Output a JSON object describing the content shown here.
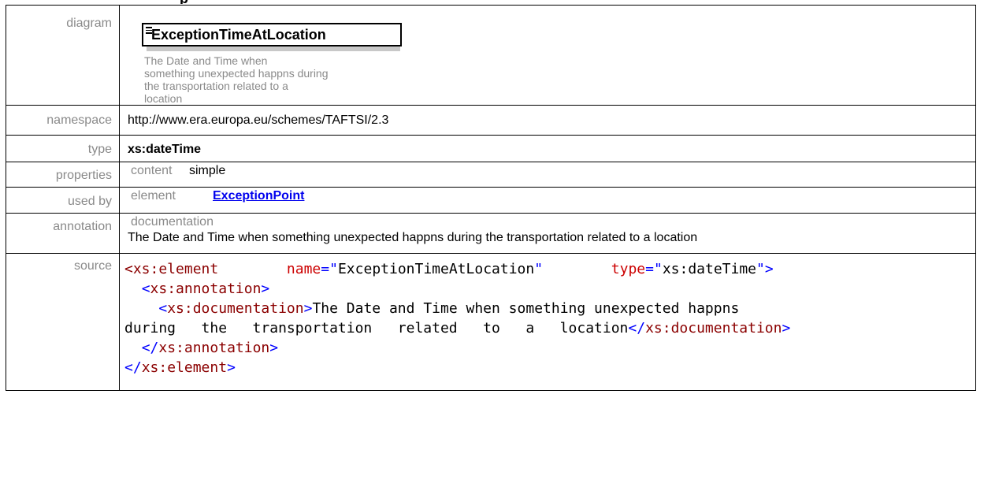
{
  "top_cut_text": "p",
  "rows": {
    "diagram": {
      "label": "diagram",
      "element_name": "ExceptionTimeAtLocation",
      "documentation_lines": [
        "The Date and Time when",
        "something unexpected happns during",
        "the transportation related to a",
        "location"
      ]
    },
    "namespace": {
      "label": "namespace",
      "value": "http://www.era.europa.eu/schemes/TAFTSI/2.3"
    },
    "type": {
      "label": "type",
      "value": "xs:dateTime"
    },
    "properties": {
      "label": "properties",
      "key": "content",
      "value": "simple"
    },
    "used_by": {
      "label": "used by",
      "kind": "element",
      "link": "ExceptionPoint"
    },
    "annotation": {
      "label": "annotation",
      "key": "documentation",
      "text": "The Date and Time when something unexpected happns during the transportation related to a location"
    },
    "source": {
      "label": "source",
      "lines": [
        [
          {
            "c": "tg",
            "t": "<xs:element"
          },
          {
            "c": "tx",
            "t": "        "
          },
          {
            "c": "at",
            "t": "name"
          },
          {
            "c": "pn",
            "t": "="
          },
          {
            "c": "st",
            "t": "\""
          },
          {
            "c": "tx",
            "t": "ExceptionTimeAtLocation"
          },
          {
            "c": "st",
            "t": "\""
          },
          {
            "c": "tx",
            "t": "        "
          },
          {
            "c": "at",
            "t": "type"
          },
          {
            "c": "pn",
            "t": "="
          },
          {
            "c": "st",
            "t": "\""
          },
          {
            "c": "tx",
            "t": "xs:dateTime"
          },
          {
            "c": "st",
            "t": "\""
          },
          {
            "c": "pn",
            "t": ">"
          }
        ],
        [
          {
            "c": "tx",
            "t": "  "
          },
          {
            "c": "pn",
            "t": "<"
          },
          {
            "c": "tg",
            "t": "xs:annotation"
          },
          {
            "c": "pn",
            "t": ">"
          }
        ],
        [
          {
            "c": "tx",
            "t": "    "
          },
          {
            "c": "pn",
            "t": "<"
          },
          {
            "c": "tg",
            "t": "xs:documentation"
          },
          {
            "c": "pn",
            "t": ">"
          },
          {
            "c": "tx",
            "t": "The Date and Time when something unexpected happns"
          }
        ],
        [
          {
            "c": "tx",
            "t": "during   the   transportation   related   to   a   location"
          },
          {
            "c": "pn",
            "t": "</"
          },
          {
            "c": "tg",
            "t": "xs:documentation"
          },
          {
            "c": "pn",
            "t": ">"
          }
        ],
        [
          {
            "c": "tx",
            "t": "  "
          },
          {
            "c": "pn",
            "t": "</"
          },
          {
            "c": "tg",
            "t": "xs:annotation"
          },
          {
            "c": "pn",
            "t": ">"
          }
        ],
        [
          {
            "c": "pn",
            "t": "</"
          },
          {
            "c": "tg",
            "t": "xs:element"
          },
          {
            "c": "pn",
            "t": ">"
          }
        ]
      ]
    }
  }
}
